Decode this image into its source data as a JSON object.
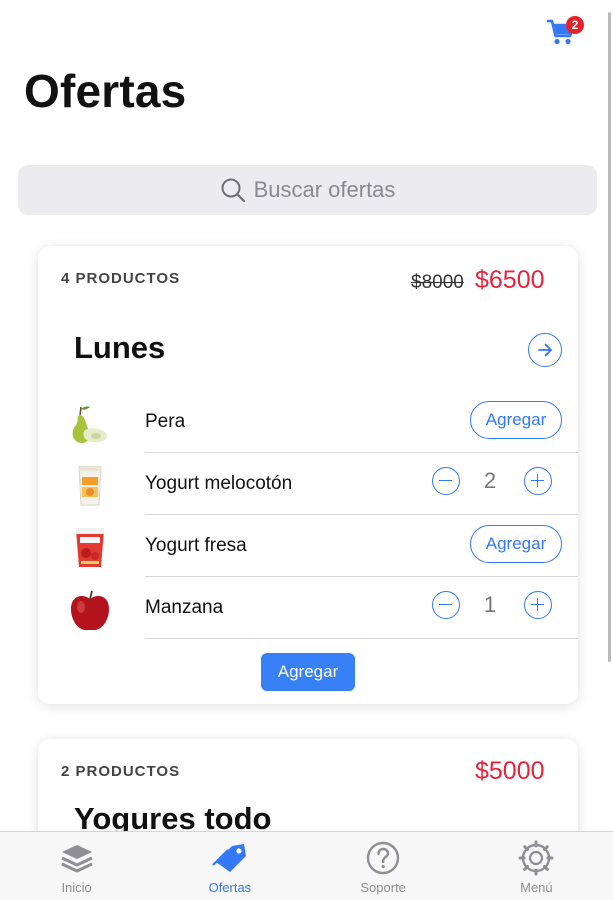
{
  "header": {
    "title": "Ofertas",
    "cart_badge": "2"
  },
  "search": {
    "placeholder": "Buscar ofertas"
  },
  "offers": [
    {
      "count_label": "4 PRODUCTOS",
      "old_price": "$8000",
      "price": "$6500",
      "title": "Lunes",
      "items": [
        {
          "name": "Pera",
          "action": "Agregar",
          "icon": "pear-image"
        },
        {
          "name": "Yogurt melocotón",
          "quantity": "2",
          "icon": "peach-yogurt-image"
        },
        {
          "name": "Yogurt fresa",
          "action": "Agregar",
          "icon": "strawberry-yogurt-image"
        },
        {
          "name": "Manzana",
          "quantity": "1",
          "icon": "apple-image"
        }
      ],
      "add_all_label": "Agregar"
    },
    {
      "count_label": "2 PRODUCTOS",
      "price": "$5000",
      "title": "Yogures todo"
    }
  ],
  "tabbar": {
    "tabs": [
      {
        "label": "Inicio",
        "icon": "layers-icon"
      },
      {
        "label": "Ofertas",
        "icon": "tag-icon",
        "active": true
      },
      {
        "label": "Soporte",
        "icon": "help-circle-icon"
      },
      {
        "label": "Menú",
        "icon": "settings-icon"
      }
    ]
  },
  "colors": {
    "accent": "#3478f6",
    "price": "#e5243b",
    "badge": "#e8222b"
  }
}
